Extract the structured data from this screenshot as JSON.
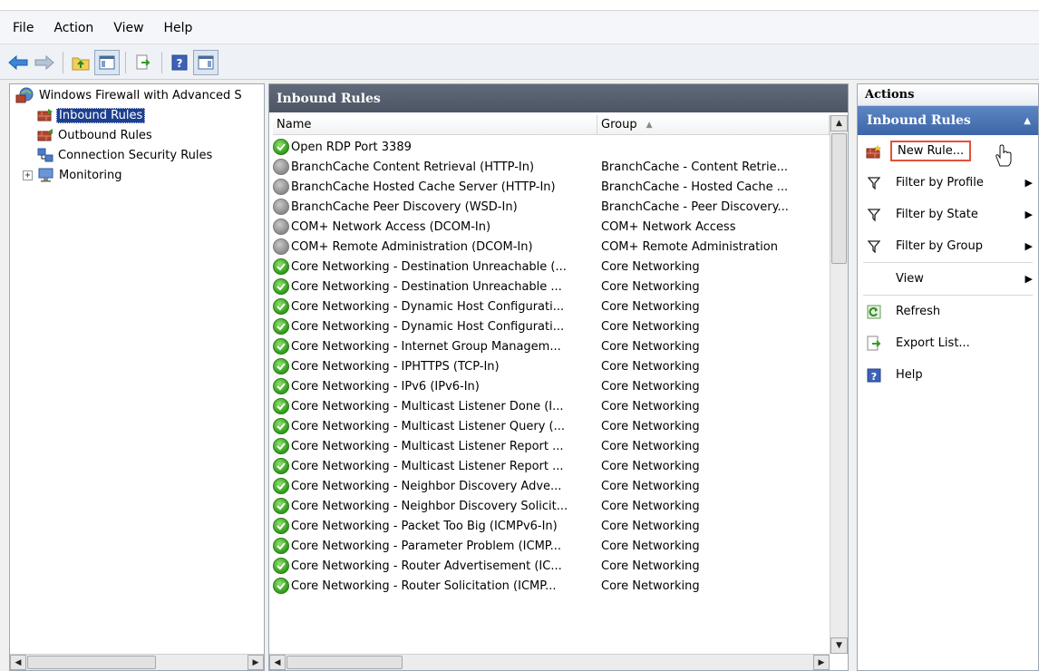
{
  "menu": [
    "File",
    "Action",
    "View",
    "Help"
  ],
  "toolbar_icons": [
    "back-arrow-icon",
    "forward-arrow-icon",
    "up-folder-icon",
    "show-hide-tree-icon",
    "export-list-icon",
    "help-icon",
    "show-hide-action-pane-icon"
  ],
  "tree": {
    "root": "Windows Firewall with Advanced S",
    "items": [
      {
        "label": "Inbound Rules",
        "selected": true
      },
      {
        "label": "Outbound Rules",
        "selected": false
      },
      {
        "label": "Connection Security Rules",
        "selected": false
      },
      {
        "label": "Monitoring",
        "selected": false
      }
    ]
  },
  "main": {
    "title": "Inbound Rules",
    "columns": {
      "name": "Name",
      "group": "Group",
      "sort_indicator": "▲"
    },
    "rows": [
      {
        "name": "Open RDP Port 3389",
        "group": "",
        "enabled": true
      },
      {
        "name": "BranchCache Content Retrieval (HTTP-In)",
        "group": "BranchCache - Content Retrie...",
        "enabled": false
      },
      {
        "name": "BranchCache Hosted Cache Server (HTTP-In)",
        "group": "BranchCache - Hosted Cache ...",
        "enabled": false
      },
      {
        "name": "BranchCache Peer Discovery (WSD-In)",
        "group": "BranchCache - Peer Discovery...",
        "enabled": false
      },
      {
        "name": "COM+ Network Access (DCOM-In)",
        "group": "COM+ Network Access",
        "enabled": false
      },
      {
        "name": "COM+ Remote Administration (DCOM-In)",
        "group": "COM+ Remote Administration",
        "enabled": false
      },
      {
        "name": "Core Networking - Destination Unreachable (...",
        "group": "Core Networking",
        "enabled": true
      },
      {
        "name": "Core Networking - Destination Unreachable ...",
        "group": "Core Networking",
        "enabled": true
      },
      {
        "name": "Core Networking - Dynamic Host Configurati...",
        "group": "Core Networking",
        "enabled": true
      },
      {
        "name": "Core Networking - Dynamic Host Configurati...",
        "group": "Core Networking",
        "enabled": true
      },
      {
        "name": "Core Networking - Internet Group Managem...",
        "group": "Core Networking",
        "enabled": true
      },
      {
        "name": "Core Networking - IPHTTPS (TCP-In)",
        "group": "Core Networking",
        "enabled": true
      },
      {
        "name": "Core Networking - IPv6 (IPv6-In)",
        "group": "Core Networking",
        "enabled": true
      },
      {
        "name": "Core Networking - Multicast Listener Done (I...",
        "group": "Core Networking",
        "enabled": true
      },
      {
        "name": "Core Networking - Multicast Listener Query (...",
        "group": "Core Networking",
        "enabled": true
      },
      {
        "name": "Core Networking - Multicast Listener Report ...",
        "group": "Core Networking",
        "enabled": true
      },
      {
        "name": "Core Networking - Multicast Listener Report ...",
        "group": "Core Networking",
        "enabled": true
      },
      {
        "name": "Core Networking - Neighbor Discovery Adve...",
        "group": "Core Networking",
        "enabled": true
      },
      {
        "name": "Core Networking - Neighbor Discovery Solicit...",
        "group": "Core Networking",
        "enabled": true
      },
      {
        "name": "Core Networking - Packet Too Big (ICMPv6-In)",
        "group": "Core Networking",
        "enabled": true
      },
      {
        "name": "Core Networking - Parameter Problem (ICMP...",
        "group": "Core Networking",
        "enabled": true
      },
      {
        "name": "Core Networking - Router Advertisement (IC...",
        "group": "Core Networking",
        "enabled": true
      },
      {
        "name": "Core Networking - Router Solicitation (ICMP...",
        "group": "Core Networking",
        "enabled": true
      }
    ]
  },
  "actions": {
    "title": "Actions",
    "section": "Inbound Rules",
    "items": [
      {
        "label": "New Rule...",
        "icon": "new-rule-icon",
        "submenu": false
      },
      {
        "label": "Filter by Profile",
        "icon": "filter-icon",
        "submenu": true
      },
      {
        "label": "Filter by State",
        "icon": "filter-icon",
        "submenu": true
      },
      {
        "label": "Filter by Group",
        "icon": "filter-icon",
        "submenu": true
      },
      {
        "label": "View",
        "icon": "",
        "submenu": true
      },
      {
        "label": "Refresh",
        "icon": "refresh-icon",
        "submenu": false
      },
      {
        "label": "Export List...",
        "icon": "export-list-icon",
        "submenu": false
      },
      {
        "label": "Help",
        "icon": "help-icon",
        "submenu": false
      }
    ]
  },
  "colors": {
    "title_bar": "#4c5563",
    "action_section": "#3c66a7",
    "highlight_box": "#e2513a",
    "rule_enabled": "#2f9b1c",
    "rule_disabled": "#8a8a8a"
  }
}
